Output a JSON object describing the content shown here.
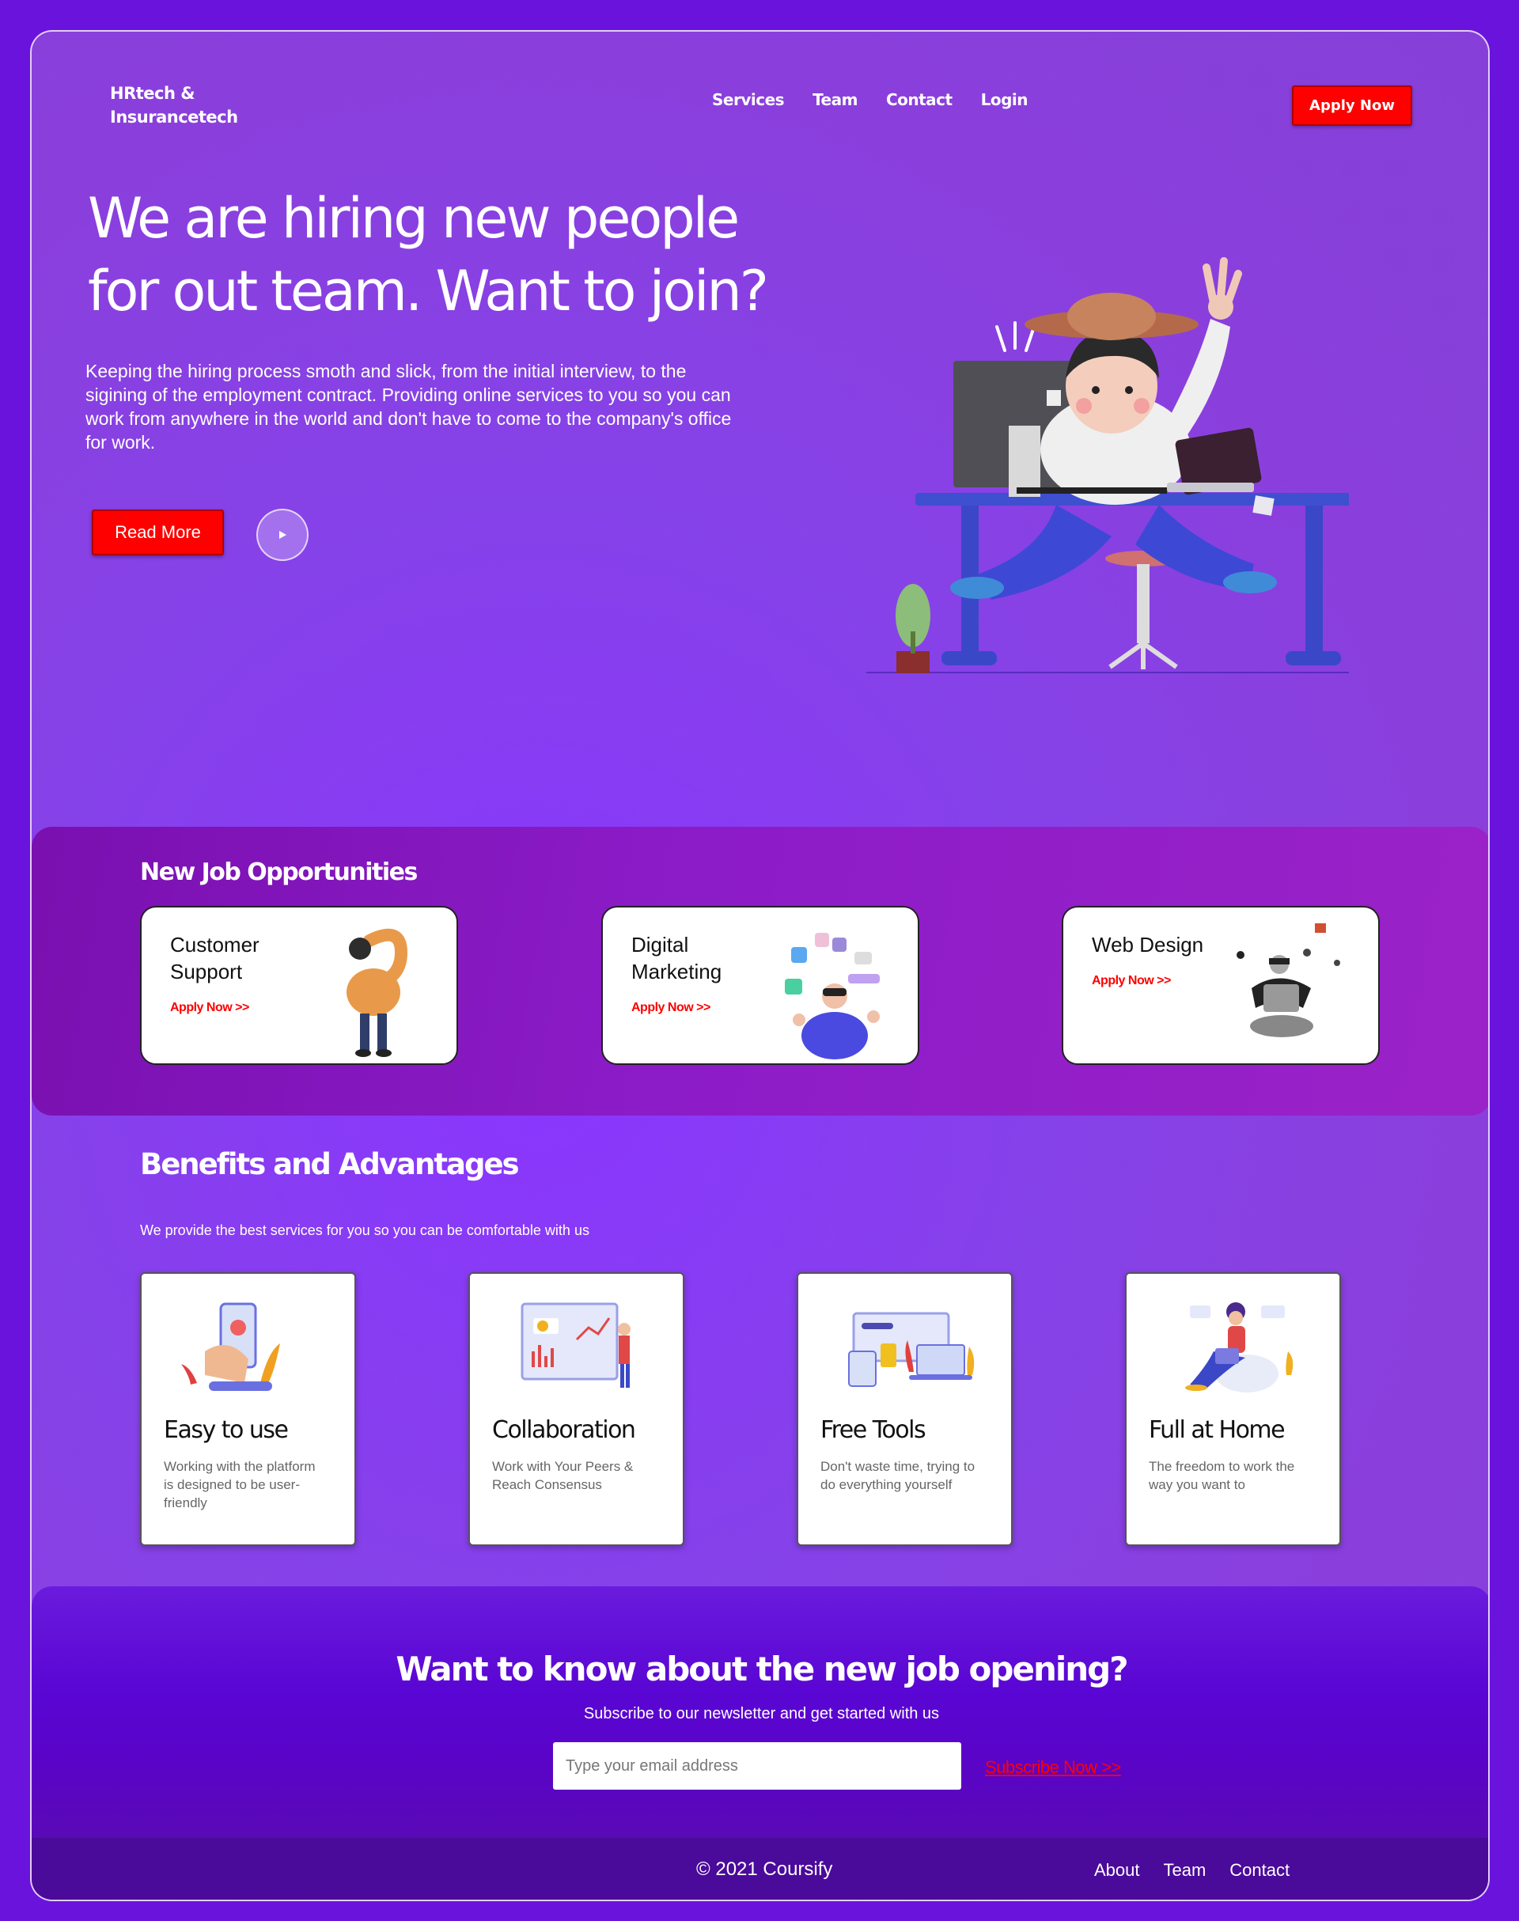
{
  "brand": {
    "line1": "HRtech &",
    "line2": "Insurancetech"
  },
  "nav": {
    "items": [
      "Services",
      "Team",
      "Contact",
      "Login"
    ],
    "cta": "Apply Now"
  },
  "hero": {
    "title_line1": "We are hiring new people",
    "title_line2": "for out team. Want to join?",
    "text": "Keeping the hiring process smoth and slick, from the initial interview, to the sigining of the employment contract. Providing online services to you so you can work from anywhere in the world and don't have to come to the company's office for work.",
    "read_more": "Read More",
    "play_icon": "play-icon"
  },
  "jobs": {
    "title": "New Job Opportunities",
    "cards": [
      {
        "title": "Customer Support",
        "link": "Apply Now >>"
      },
      {
        "title": "Digital Marketing",
        "link": "Apply Now >>"
      },
      {
        "title": "Web Design",
        "link": "Apply Now >>"
      }
    ]
  },
  "benefits": {
    "title": "Benefits and Advantages",
    "subtitle": "We provide the best services for you so you can be comfortable with us",
    "cards": [
      {
        "title": "Easy to use",
        "desc": "Working with the platform is designed to be user-friendly"
      },
      {
        "title": "Collaboration",
        "desc": "Work with Your Peers & Reach Consensus"
      },
      {
        "title": "Free Tools",
        "desc": "Don't waste time, trying to do everything yourself"
      },
      {
        "title": "Full at Home",
        "desc": "The freedom to work the way you want to"
      }
    ]
  },
  "newsletter": {
    "title": "Want to know about the new job opening?",
    "subtitle": "Subscribe to our newsletter and get started with us",
    "email_placeholder": "Type your email address",
    "subscribe": "Subscribe Now >>"
  },
  "footer": {
    "copyright": "© 2021 Coursify",
    "links": [
      "About",
      "Team",
      "Contact"
    ]
  },
  "colors": {
    "background": "#6a13dc",
    "accent_red": "#fe0000",
    "card_bg": "#ffffff"
  }
}
